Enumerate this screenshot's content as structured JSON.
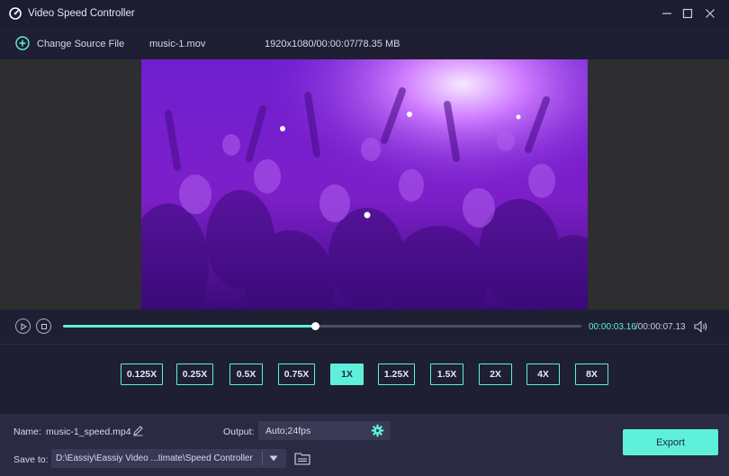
{
  "window": {
    "title": "Video Speed Controller",
    "icons": [
      "speedometer-icon",
      "minimize-icon",
      "maximize-icon",
      "close-icon"
    ]
  },
  "source": {
    "change_label": "Change Source File",
    "file_name": "music-1.mov",
    "file_meta": "1920x1080/00:00:07/78.35 MB"
  },
  "player": {
    "progress": 0.486,
    "current_time": "00:00:03.16",
    "total_time": "/00:00:07.13"
  },
  "speeds": {
    "options": [
      "0.125X",
      "0.25X",
      "0.5X",
      "0.75X",
      "1X",
      "1.25X",
      "1.5X",
      "2X",
      "4X",
      "8X"
    ],
    "selected": "1X"
  },
  "output": {
    "name_label": "Name:",
    "name_value": "music-1_speed.mp4",
    "output_label": "Output:",
    "output_value": "Auto;24fps",
    "save_label": "Save to:",
    "save_path": "D:\\Eassiy\\Eassiy Video ...timate\\Speed Controller",
    "export_label": "Export"
  },
  "colors": {
    "accent": "#5ef0da",
    "background": "#1e1f33",
    "panel": "#2a2b42",
    "field": "#383a55"
  }
}
